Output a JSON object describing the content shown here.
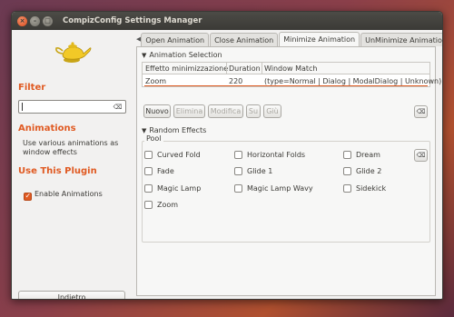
{
  "window": {
    "title": "CompizConfig Settings Manager",
    "controls": {
      "close": "×",
      "minimize": "–",
      "maximize": "□"
    }
  },
  "sidebar": {
    "icon": "genie-lamp-icon",
    "filter_heading": "Filter",
    "filter_value": "",
    "filter_clear_icon": "⌫",
    "plugin_heading": "Animations",
    "plugin_description": "Use various animations as window effects",
    "use_plugin_heading": "Use This Plugin",
    "enable_label": "Enable Animations",
    "enable_checked": true,
    "back_button": "Indietro"
  },
  "tabs": {
    "scroll_left": "◀",
    "scroll_right": "▶",
    "items": [
      {
        "label": "Open Animation",
        "active": false
      },
      {
        "label": "Close Animation",
        "active": false
      },
      {
        "label": "Minimize Animation",
        "active": true
      },
      {
        "label": "UnMinimize Animation",
        "active": false
      }
    ]
  },
  "animation_selection": {
    "heading": "Animation Selection",
    "expander": "▼",
    "columns": [
      "Effetto minimizzazione",
      "Duration",
      "Window Match"
    ],
    "rows": [
      {
        "effect": "Zoom",
        "duration": "220",
        "match": "(type=Normal | Dialog | ModalDialog | Unknown)"
      }
    ],
    "buttons": [
      {
        "label": "Nuovo",
        "enabled": true
      },
      {
        "label": "Elimina",
        "enabled": false
      },
      {
        "label": "Modifica",
        "enabled": false
      },
      {
        "label": "Su",
        "enabled": false
      },
      {
        "label": "Giù",
        "enabled": false
      }
    ],
    "reset_icon": "⌫"
  },
  "random_effects": {
    "heading": "Random Effects",
    "expander": "▼",
    "pool_label": "Pool",
    "reset_icon": "⌫",
    "options": [
      {
        "label": "Curved Fold",
        "checked": false
      },
      {
        "label": "Horizontal Folds",
        "checked": false
      },
      {
        "label": "Dream",
        "checked": false
      },
      {
        "label": "Fade",
        "checked": false
      },
      {
        "label": "Glide 1",
        "checked": false
      },
      {
        "label": "Glide 2",
        "checked": false
      },
      {
        "label": "Magic Lamp",
        "checked": false
      },
      {
        "label": "Magic Lamp Wavy",
        "checked": false
      },
      {
        "label": "Sidekick",
        "checked": false
      },
      {
        "label": "Zoom",
        "checked": false
      }
    ]
  },
  "colors": {
    "accent": "#e05a22",
    "titlebar": "#3b3a36",
    "window_bg": "#f2f1f0"
  }
}
